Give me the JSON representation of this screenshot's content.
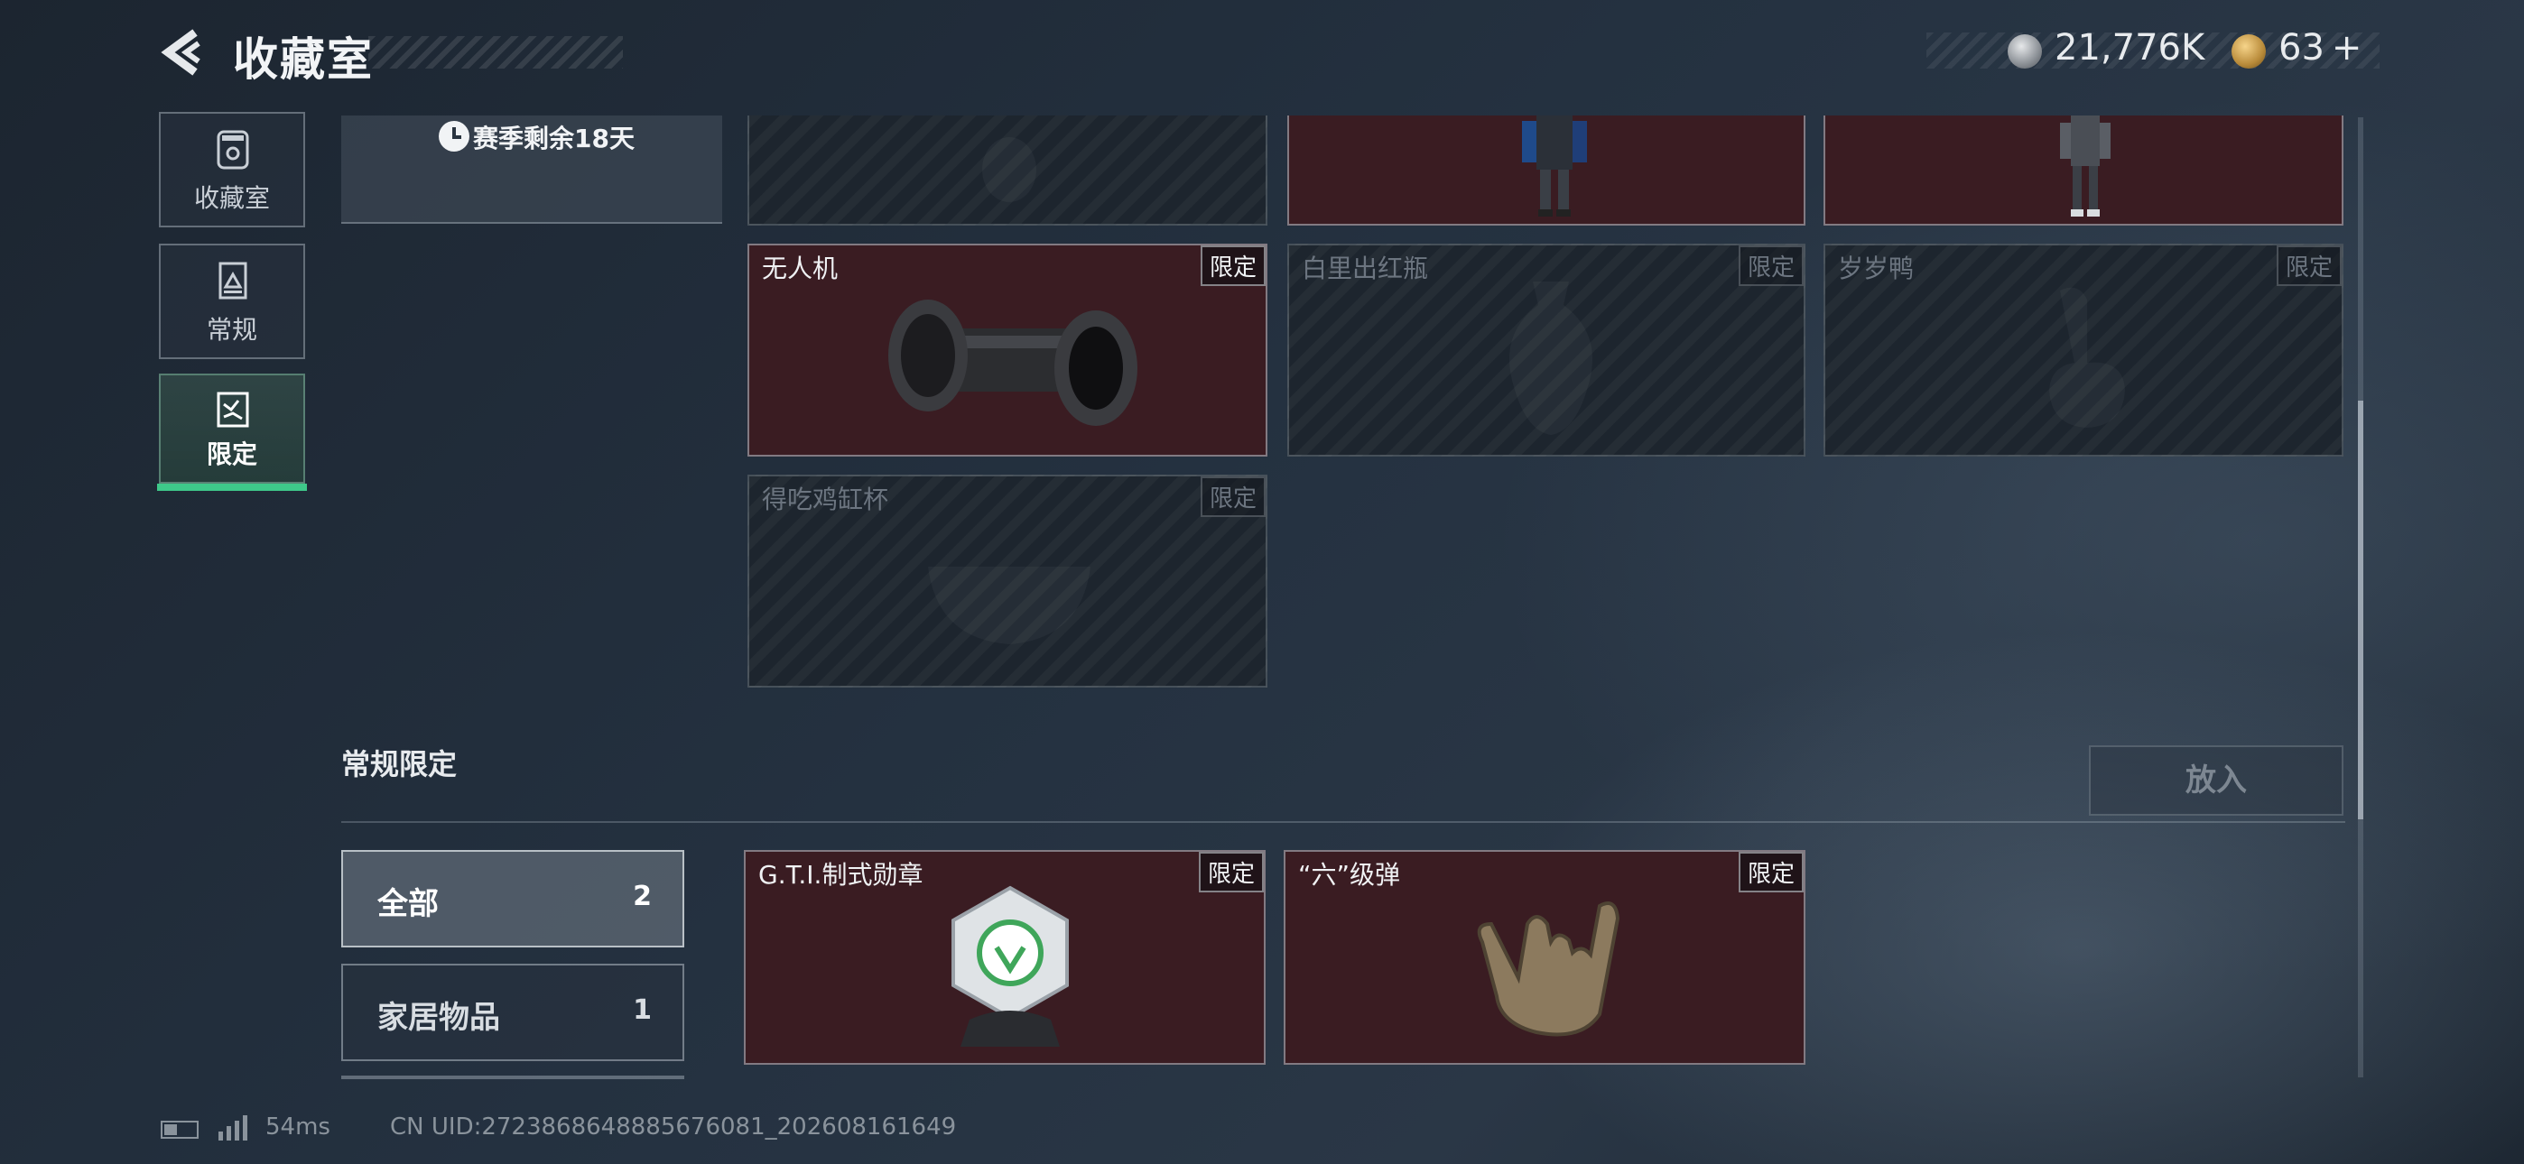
{
  "header": {
    "title": "收藏室",
    "currency1_value": "21,776K",
    "currency2_value": "63",
    "currency2_plus": "+"
  },
  "nav": {
    "items": [
      {
        "label": "收藏室"
      },
      {
        "label": "常规"
      },
      {
        "label": "限定"
      }
    ]
  },
  "season": {
    "text": "赛季剩余18天"
  },
  "cards": [
    {
      "name": "无人机",
      "tag": "限定"
    },
    {
      "name": "白里出红瓶",
      "tag": "限定"
    },
    {
      "name": "岁岁鸭",
      "tag": "限定"
    },
    {
      "name": "得吃鸡缸杯",
      "tag": "限定"
    },
    {
      "name": "G.T.I.制式勋章",
      "tag": "限定"
    },
    {
      "name": "“六”级弹",
      "tag": "限定"
    }
  ],
  "section": {
    "title": "常规限定",
    "put_label": "放入"
  },
  "filters": [
    {
      "label": "全部",
      "count": "2"
    },
    {
      "label": "家居物品",
      "count": "1"
    }
  ],
  "footer": {
    "ping": "54ms",
    "uid": "CN UID:2723868648885676081_202608161649"
  },
  "colors": {
    "accent": "#3ec98a",
    "owned_card": "#3a1c22",
    "empty_card": "#1d252e"
  }
}
